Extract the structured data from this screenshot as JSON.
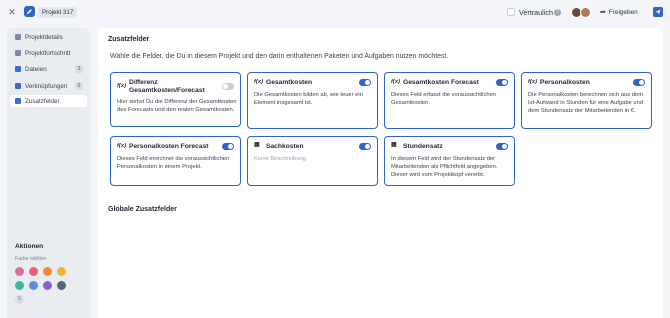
{
  "header": {
    "close_icon": "close-icon",
    "project_icon": "edit-icon",
    "project_name": "Projekt 317",
    "confidential_label": "Vertraulich",
    "help_icon": "help-icon",
    "share_label": "Freigeben",
    "share_icon": "share-icon"
  },
  "sidebar": {
    "items": [
      {
        "label": "Projektdetails",
        "icon": "document-icon",
        "icon_color": "#7b8aa6",
        "count": ""
      },
      {
        "label": "Projektfortschritt",
        "icon": "chart-icon",
        "icon_color": "#7b8aa6",
        "count": ""
      },
      {
        "label": "Dateien",
        "icon": "folder-icon",
        "icon_color": "#3d6ec9",
        "count": "3"
      },
      {
        "label": "Verknüpfungen",
        "icon": "link-icon",
        "icon_color": "#3d6ec9",
        "count": "0"
      },
      {
        "label": "Zusatzfelder",
        "icon": "layers-icon",
        "icon_color": "#3d6ec9",
        "count": ""
      }
    ],
    "active_item": "Zusatzfelder",
    "actions_title": "Aktionen",
    "color_label": "Farbe wählen",
    "colors": [
      "#e06c9f",
      "#e8626a",
      "#f08a3c",
      "#f2b52c",
      "#3fb6a0",
      "#5a8fd8",
      "#8a63c8",
      "#596273"
    ],
    "no_color_symbol": "S"
  },
  "main": {
    "title": "Zusatzfelder",
    "description": "Wähle die Felder, die Du in diesem Projekt und den darin enthaltenen Paketen und Aufgaben nutzen möchtest.",
    "cards": [
      {
        "title": "Differenz Gesamtkosten/Forecast",
        "icon": "formula-icon",
        "icon_text": "f(x)",
        "enabled": false,
        "description": "Hier siehst Du die Differenz der Gesamtkosten des Forecasts und den realen Gesamtkosten."
      },
      {
        "title": "Gesamtkosten",
        "icon": "formula-icon",
        "icon_text": "f(x)",
        "enabled": true,
        "description": "Die Gesamtkosten bilden ab, wie teuer ein Element insgesamt ist."
      },
      {
        "title": "Gesamtkosten Forecast",
        "icon": "formula-icon",
        "icon_text": "f(x)",
        "enabled": true,
        "description": "Dieses Feld erfasst die voraussichtlichen Gesamtkosten."
      },
      {
        "title": "Personalkosten",
        "icon": "formula-icon",
        "icon_text": "f(x)",
        "enabled": true,
        "description": "Die Personalkosten berechnen sich aus dem Ist-Aufwand in Stunden für eine Aufgabe und dem Stundensatz der Mitarbeitenden in €."
      },
      {
        "title": "Personalkosten Forecast",
        "icon": "formula-icon",
        "icon_text": "f(x)",
        "enabled": true,
        "description": "Dieses Feld errechnet die voraussichtlichen Personalkosten in einem Projekt."
      },
      {
        "title": "Sachkosten",
        "icon": "grid-icon",
        "icon_text": "▦",
        "enabled": true,
        "description": "Keine Beschreibung",
        "muted": true
      },
      {
        "title": "Stundensatz",
        "icon": "grid-icon",
        "icon_text": "▦",
        "enabled": true,
        "description": "In diesem Feld wird der Stundensatz der Mitarbeitenden als Pflichtfeld angegeben. Dieser wird vom Projektkopf vererbt."
      }
    ],
    "global_title": "Globale Zusatzfelder"
  }
}
